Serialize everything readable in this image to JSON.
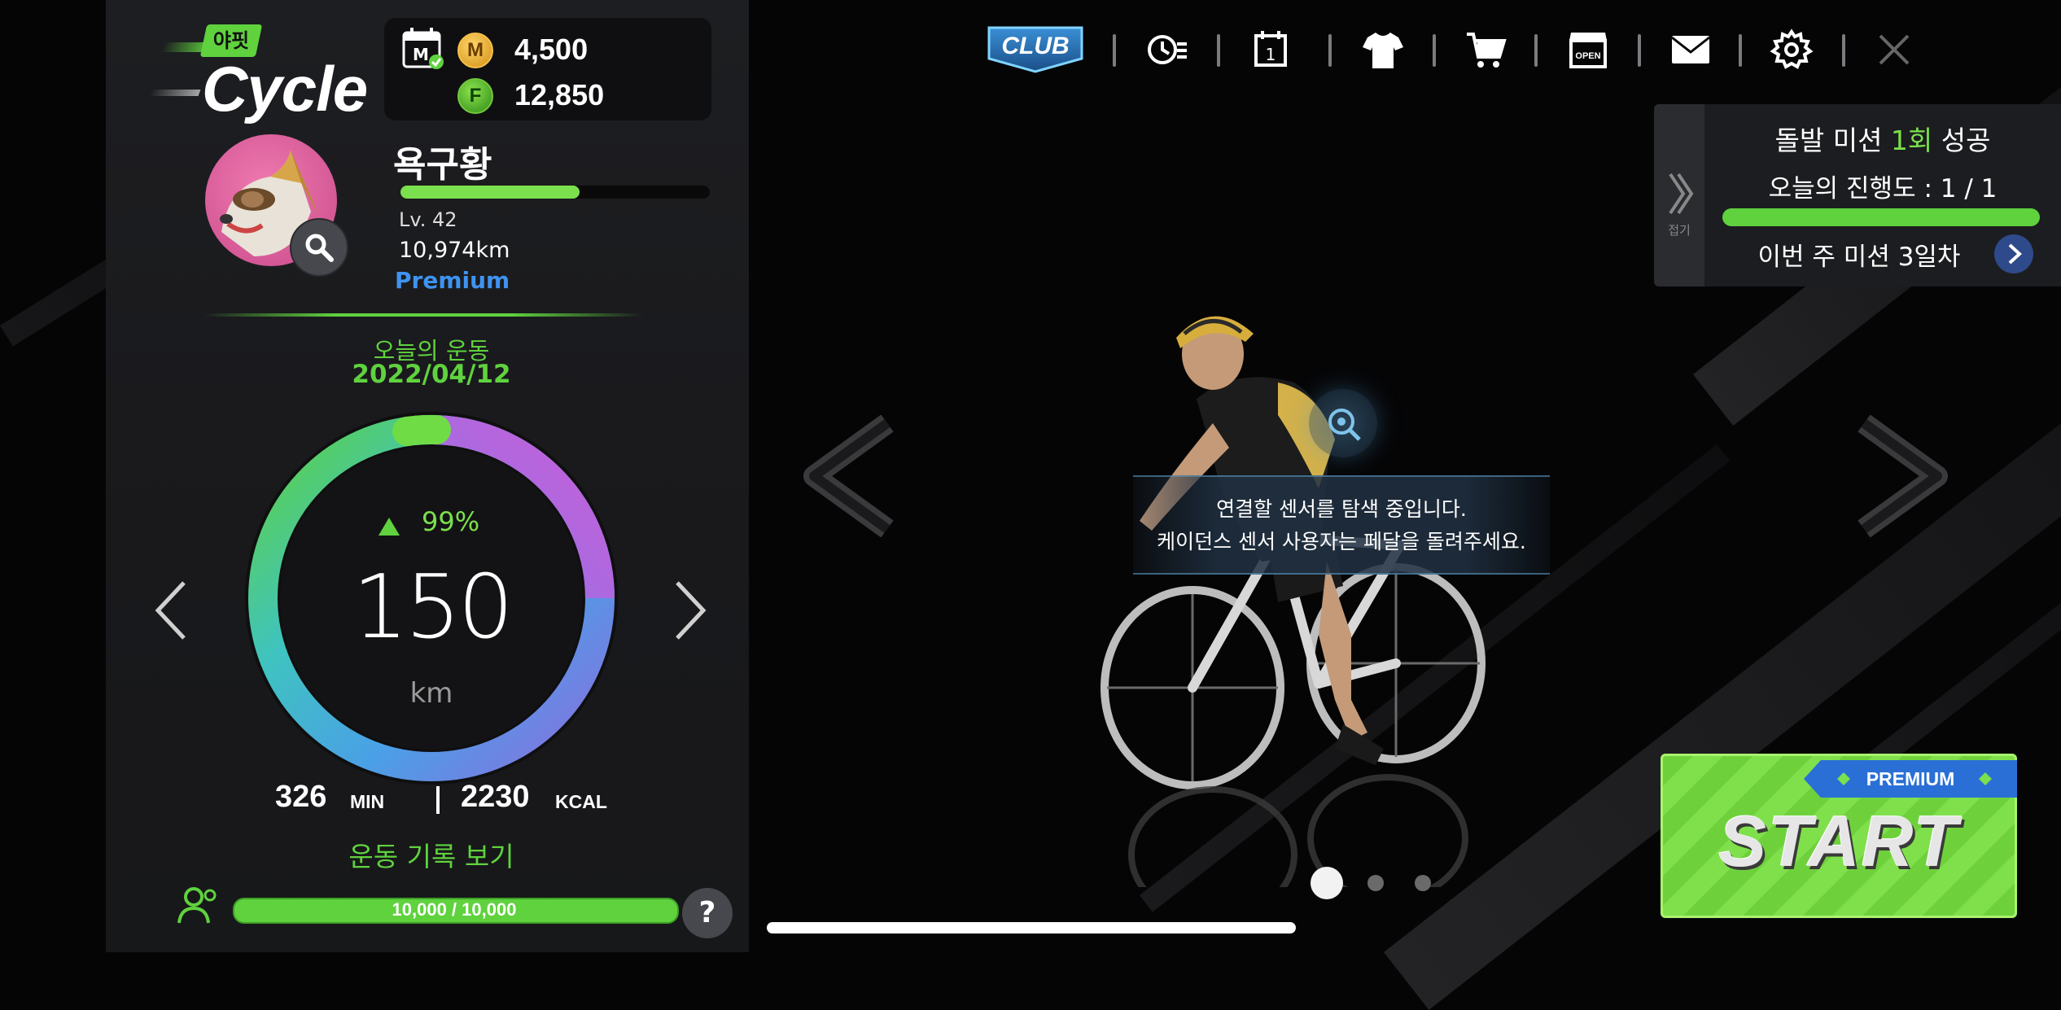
{
  "app": {
    "logo_tag": "야핏",
    "logo_name": "Cycle"
  },
  "currency": {
    "m_coin_symbol": "M",
    "m_coin_value": "4,500",
    "f_coin_symbol": "F",
    "f_coin_value": "12,850"
  },
  "profile": {
    "username": "욕구황",
    "xp_progress": 0.58,
    "level": "Lv.  42",
    "total_distance": "10,974km",
    "membership": "Premium"
  },
  "today": {
    "label": "오늘의 운동",
    "date": "2022/04/12",
    "change_pct": "99%",
    "value": "150",
    "unit": "km",
    "progress": 1.0,
    "minutes": "326",
    "minutes_unit": "MIN",
    "kcal": "2230",
    "kcal_unit": "KCAL",
    "record_link": "운동 기록 보기"
  },
  "energy": {
    "text": "10,000  /  10,000",
    "fill": 1.0,
    "help": "?"
  },
  "nav": {
    "club_label": "CLUB",
    "items": [
      "club-icon",
      "history-icon",
      "calendar-icon",
      "shirt-icon",
      "cart-icon",
      "shop-icon",
      "mail-icon",
      "gear-icon",
      "close-icon"
    ],
    "calendar_day": "1",
    "shop_label": "OPEN"
  },
  "mission": {
    "fold_label": "접기",
    "title_prefix": "돌발 미션 ",
    "title_count": "1회",
    "title_suffix": " 성공",
    "progress_text": "오늘의 진행도 : 1 / 1",
    "progress": 1.0,
    "week_text": "이번 주 미션 3일차"
  },
  "sensor": {
    "line1": "연결할 센서를 탐색 중입니다.",
    "line2": "케이던스 센서 사용자는 페달을 돌려주세요."
  },
  "carousel": {
    "pages": 3,
    "active": 0
  },
  "start": {
    "premium_label": "PREMIUM",
    "label": "START"
  },
  "colors": {
    "accent_green": "#5fd23e",
    "premium_blue": "#3f93f0",
    "ring_start": "#5fd23e",
    "ring_end": "#c060d8"
  }
}
